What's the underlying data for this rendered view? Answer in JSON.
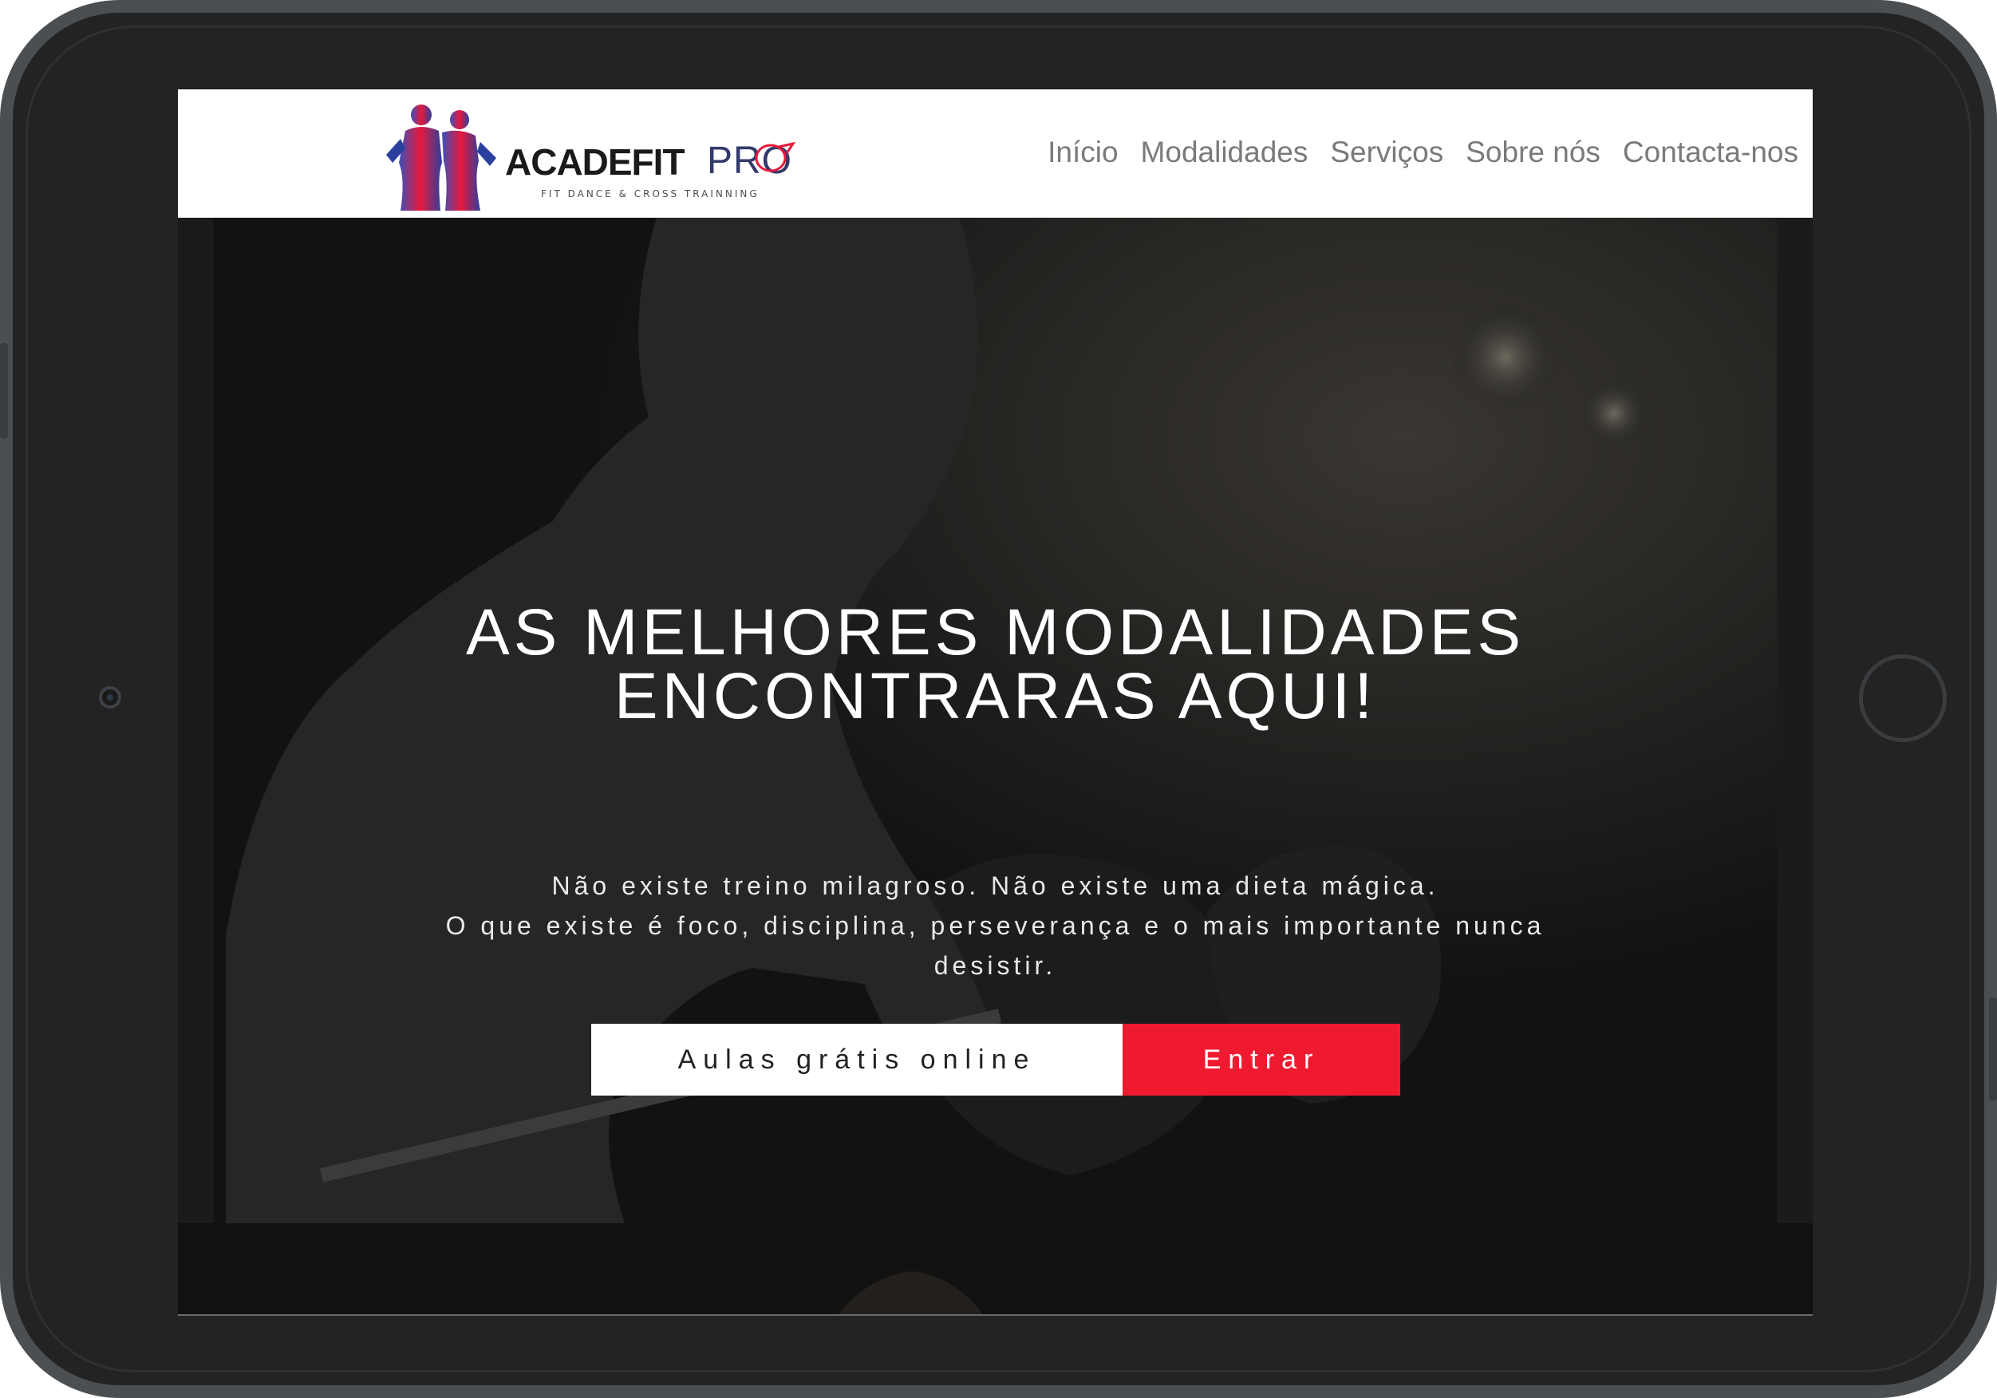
{
  "brand": {
    "name": "ACADEFIT",
    "suffix": "PRO",
    "tagline": "FIT DANCE & CROSS TRAINNING"
  },
  "nav": {
    "items": [
      {
        "label": "Início"
      },
      {
        "label": "Modalidades"
      },
      {
        "label": "Serviços"
      },
      {
        "label": "Sobre nós"
      },
      {
        "label": "Contacta-nos"
      }
    ]
  },
  "hero": {
    "title_line1": "AS MELHORES MODALIDADES",
    "title_line2": "ENCONTRARAS AQUI!",
    "text_line1": "Não existe treino milagroso. Não existe uma dieta mágica.",
    "text_line2": "O que existe é foco, disciplina, perseverança e o mais importante nunca",
    "text_line3": "desistir.",
    "input_placeholder": "Aulas grátis online",
    "button_label": "Entrar"
  },
  "colors": {
    "accent": "#f01a30",
    "nav_text": "#7a7a7a",
    "device_frame": "#232323"
  },
  "icons": {
    "logo": "athletes-silhouette-icon",
    "camera": "camera-icon",
    "home": "home-button-icon"
  }
}
